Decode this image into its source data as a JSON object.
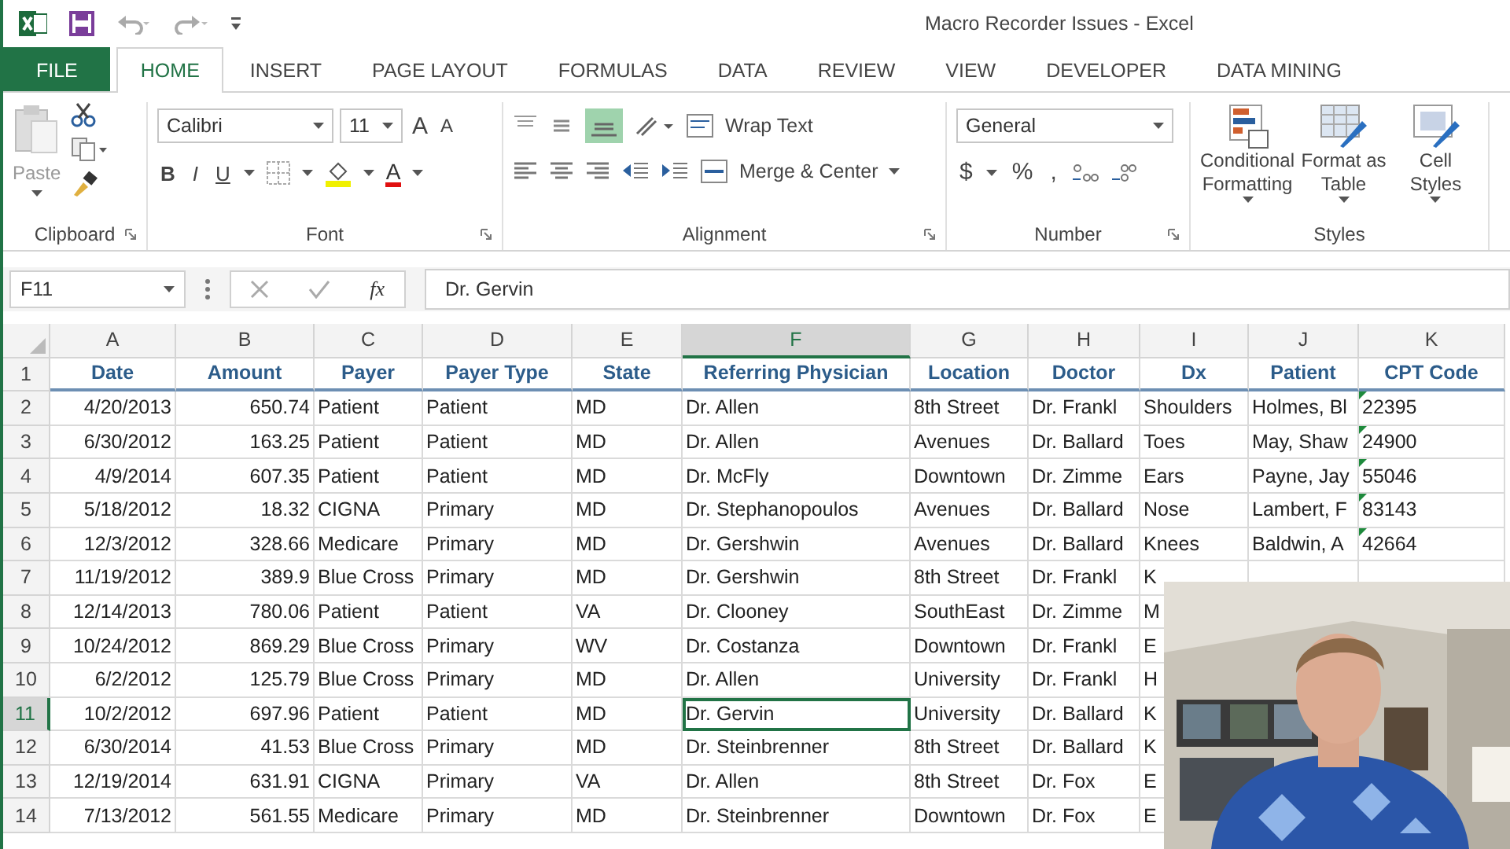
{
  "window": {
    "title": "Macro Recorder Issues - Excel"
  },
  "tabs": [
    {
      "label": "FILE",
      "kind": "file",
      "selected": false
    },
    {
      "label": "HOME",
      "kind": "tab",
      "selected": true
    },
    {
      "label": "INSERT",
      "kind": "tab",
      "selected": false
    },
    {
      "label": "PAGE LAYOUT",
      "kind": "tab",
      "selected": false
    },
    {
      "label": "FORMULAS",
      "kind": "tab",
      "selected": false
    },
    {
      "label": "DATA",
      "kind": "tab",
      "selected": false
    },
    {
      "label": "REVIEW",
      "kind": "tab",
      "selected": false
    },
    {
      "label": "VIEW",
      "kind": "tab",
      "selected": false
    },
    {
      "label": "DEVELOPER",
      "kind": "tab",
      "selected": false
    },
    {
      "label": "DATA MINING",
      "kind": "tab",
      "selected": false
    }
  ],
  "ribbon": {
    "clipboard": {
      "paste": "Paste",
      "group": "Clipboard"
    },
    "font": {
      "name": "Calibri",
      "size": "11",
      "grow": "A",
      "shrink": "A",
      "bold": "B",
      "italic": "I",
      "underline": "U",
      "font_color": "A",
      "group": "Font"
    },
    "alignment": {
      "wrap": "Wrap Text",
      "merge": "Merge & Center",
      "group": "Alignment"
    },
    "number": {
      "format": "General",
      "currency": "$",
      "percent": "%",
      "comma": ",",
      "group": "Number"
    },
    "styles": {
      "buttons": [
        {
          "label": "Conditional Formatting",
          "kind": "conditional"
        },
        {
          "label": "Format as Table",
          "kind": "table"
        },
        {
          "label": "Cell Styles",
          "kind": "cell"
        }
      ],
      "group": "Styles"
    }
  },
  "formula_bar": {
    "name_box": "F11",
    "fx": "fx",
    "value": "Dr. Gervin"
  },
  "sheet": {
    "columns": [
      {
        "letter": "A",
        "kind": "number",
        "selected": false
      },
      {
        "letter": "B",
        "kind": "number",
        "selected": false
      },
      {
        "letter": "C",
        "kind": "text",
        "selected": false
      },
      {
        "letter": "D",
        "kind": "text",
        "selected": false
      },
      {
        "letter": "E",
        "kind": "text",
        "selected": false
      },
      {
        "letter": "F",
        "kind": "text",
        "selected": true
      },
      {
        "letter": "G",
        "kind": "text",
        "selected": false
      },
      {
        "letter": "H",
        "kind": "text",
        "selected": false
      },
      {
        "letter": "I",
        "kind": "text",
        "selected": false
      },
      {
        "letter": "J",
        "kind": "text",
        "selected": false
      },
      {
        "letter": "K",
        "kind": "code",
        "selected": false
      }
    ],
    "rows": [
      {
        "number": "1",
        "kind": "header",
        "selected": false,
        "cells": [
          "Date",
          "Amount",
          "Payer",
          "Payer Type",
          "State",
          "Referring Physician",
          "Location",
          "Doctor",
          "Dx",
          "Patient",
          "CPT Code"
        ]
      },
      {
        "number": "2",
        "kind": "data",
        "selected": false,
        "cells": [
          "4/20/2013",
          "650.74",
          "Patient",
          "Patient",
          "MD",
          "Dr. Allen",
          "8th Street",
          "Dr. Frankl",
          "Shoulders",
          "Holmes, Bl",
          "22395"
        ]
      },
      {
        "number": "3",
        "kind": "data",
        "selected": false,
        "cells": [
          "6/30/2012",
          "163.25",
          "Patient",
          "Patient",
          "MD",
          "Dr. Allen",
          "Avenues",
          "Dr. Ballard",
          "Toes",
          "May, Shaw",
          "24900"
        ]
      },
      {
        "number": "4",
        "kind": "data",
        "selected": false,
        "cells": [
          "4/9/2014",
          "607.35",
          "Patient",
          "Patient",
          "MD",
          "Dr. McFly",
          "Downtown",
          "Dr. Zimme",
          "Ears",
          "Payne, Jay",
          "55046"
        ]
      },
      {
        "number": "5",
        "kind": "data",
        "selected": false,
        "cells": [
          "5/18/2012",
          "18.32",
          "CIGNA",
          "Primary",
          "MD",
          "Dr. Stephanopoulos",
          "Avenues",
          "Dr. Ballard",
          "Nose",
          "Lambert, F",
          "83143"
        ]
      },
      {
        "number": "6",
        "kind": "data",
        "selected": false,
        "cells": [
          "12/3/2012",
          "328.66",
          "Medicare",
          "Primary",
          "MD",
          "Dr. Gershwin",
          "Avenues",
          "Dr. Ballard",
          "Knees",
          "Baldwin, A",
          "42664"
        ]
      },
      {
        "number": "7",
        "kind": "data",
        "selected": false,
        "cells": [
          "11/19/2012",
          "389.9",
          "Blue Cross",
          "Primary",
          "MD",
          "Dr. Gershwin",
          "8th Street",
          "Dr. Frankl",
          "K"
        ]
      },
      {
        "number": "8",
        "kind": "data",
        "selected": false,
        "cells": [
          "12/14/2013",
          "780.06",
          "Patient",
          "Patient",
          "VA",
          "Dr. Clooney",
          "SouthEast",
          "Dr. Zimme",
          "M"
        ]
      },
      {
        "number": "9",
        "kind": "data",
        "selected": false,
        "cells": [
          "10/24/2012",
          "869.29",
          "Blue Cross",
          "Primary",
          "WV",
          "Dr. Costanza",
          "Downtown",
          "Dr. Frankl",
          "E"
        ]
      },
      {
        "number": "10",
        "kind": "data",
        "selected": false,
        "cells": [
          "6/2/2012",
          "125.79",
          "Blue Cross",
          "Primary",
          "MD",
          "Dr. Allen",
          "University",
          "Dr. Frankl",
          "H"
        ]
      },
      {
        "number": "11",
        "kind": "data",
        "selected": true,
        "cells": [
          "10/2/2012",
          "697.96",
          "Patient",
          "Patient",
          "MD",
          "Dr. Gervin",
          "University",
          "Dr. Ballard",
          "K"
        ]
      },
      {
        "number": "12",
        "kind": "data",
        "selected": false,
        "cells": [
          "6/30/2014",
          "41.53",
          "Blue Cross",
          "Primary",
          "MD",
          "Dr. Steinbrenner",
          "8th Street",
          "Dr. Ballard",
          "K"
        ]
      },
      {
        "number": "13",
        "kind": "data",
        "selected": false,
        "cells": [
          "12/19/2014",
          "631.91",
          "CIGNA",
          "Primary",
          "VA",
          "Dr. Allen",
          "8th Street",
          "Dr. Fox",
          "E"
        ]
      },
      {
        "number": "14",
        "kind": "data",
        "selected": false,
        "cells": [
          "7/13/2012",
          "561.55",
          "Medicare",
          "Primary",
          "MD",
          "Dr. Steinbrenner",
          "Downtown",
          "Dr. Fox",
          "E"
        ]
      }
    ]
  }
}
